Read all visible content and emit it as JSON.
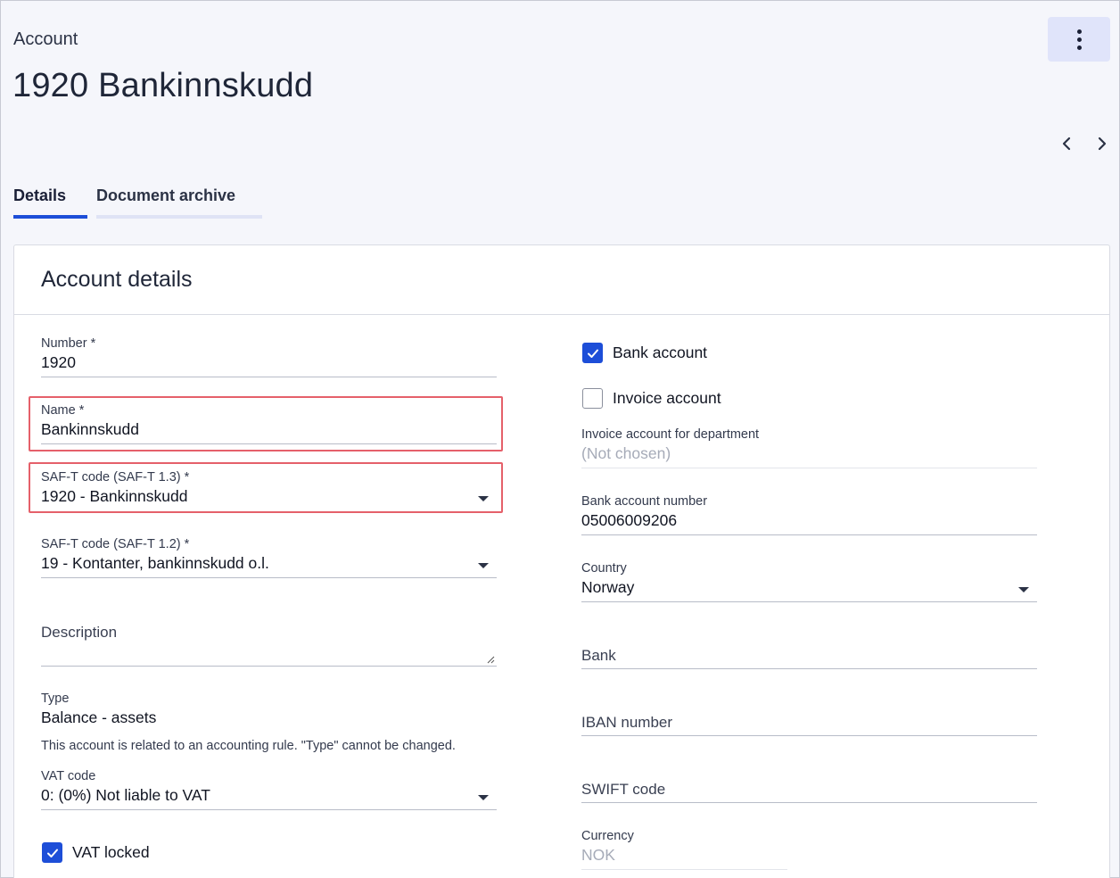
{
  "header": {
    "breadcrumb": "Account",
    "title": "1920 Bankinnskudd",
    "menu_icon": "more-vertical-icon",
    "prev_icon": "chevron-left-icon",
    "next_icon": "chevron-right-icon"
  },
  "tabs": [
    {
      "label": "Details",
      "active": true
    },
    {
      "label": "Document archive",
      "active": false
    }
  ],
  "card": {
    "title": "Account details"
  },
  "left": {
    "number": {
      "label": "Number *",
      "value": "1920"
    },
    "name": {
      "label": "Name *",
      "value": "Bankinnskudd"
    },
    "saft13": {
      "label": "SAF-T code (SAF-T 1.3) *",
      "value": "1920 - Bankinnskudd"
    },
    "saft12": {
      "label": "SAF-T code (SAF-T 1.2) *",
      "value": "19 - Kontanter, bankinnskudd o.l."
    },
    "description": {
      "label": "Description",
      "value": ""
    },
    "type": {
      "label": "Type",
      "value": "Balance - assets",
      "note": "This account is related to an accounting rule. \"Type\" cannot be changed."
    },
    "vat_code": {
      "label": "VAT code",
      "value": "0: (0%) Not liable to VAT"
    },
    "vat_locked": {
      "label": "VAT locked",
      "checked": true
    }
  },
  "right": {
    "bank_account": {
      "label": "Bank account",
      "checked": true
    },
    "invoice_account": {
      "label": "Invoice account",
      "checked": false
    },
    "invoice_dept": {
      "label": "Invoice account for department",
      "value": "(Not chosen)"
    },
    "bank_account_number": {
      "label": "Bank account number",
      "value": "05006009206"
    },
    "country": {
      "label": "Country",
      "value": "Norway"
    },
    "bank": {
      "label": "Bank"
    },
    "iban": {
      "label": "IBAN number"
    },
    "swift": {
      "label": "SWIFT code"
    },
    "currency": {
      "label": "Currency",
      "value": "NOK"
    }
  },
  "colors": {
    "accent": "#1d4ed8",
    "highlight": "#e5606a",
    "background": "#f5f6fb"
  }
}
